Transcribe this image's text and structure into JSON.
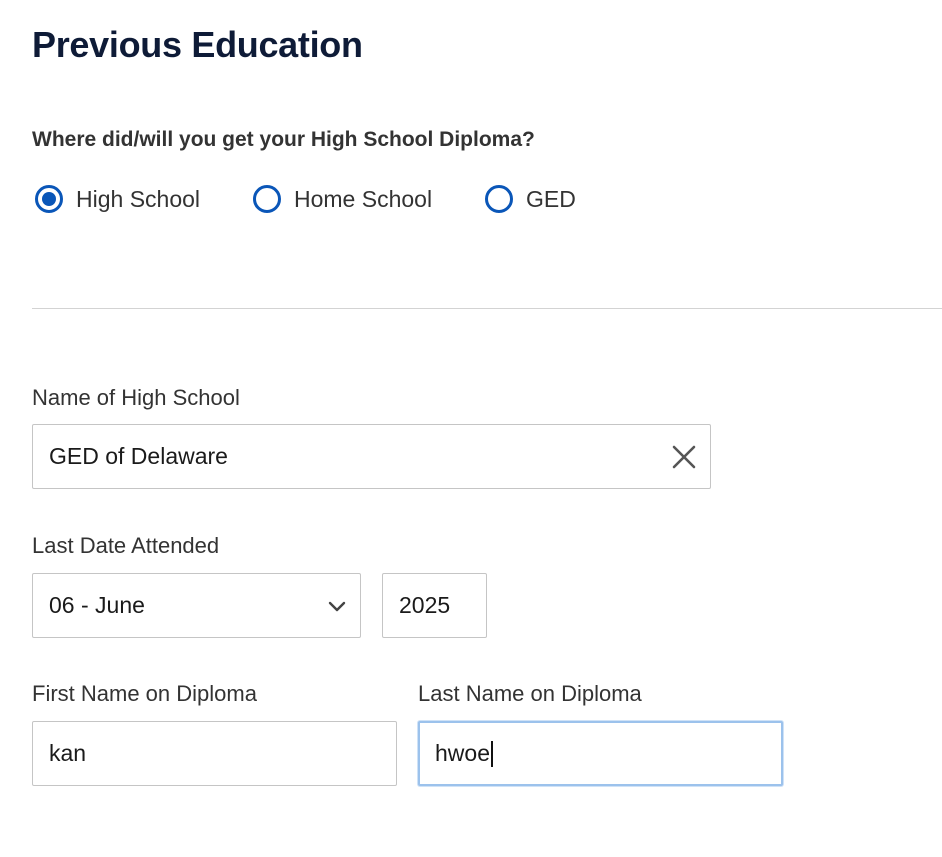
{
  "page": {
    "title": "Previous Education"
  },
  "diploma_source": {
    "question": "Where did/will you get your High School Diploma?",
    "options": [
      {
        "label": "High School",
        "selected": true
      },
      {
        "label": "Home School",
        "selected": false
      },
      {
        "label": "GED",
        "selected": false
      }
    ]
  },
  "high_school": {
    "label": "Name of High School",
    "value": "GED of Delaware",
    "clear_icon": "close-icon"
  },
  "last_date": {
    "label": "Last Date Attended",
    "month_value": "06 - June",
    "month_icon": "chevron-down-icon",
    "year_value": "2025"
  },
  "first_name": {
    "label": "First Name on Diploma",
    "value": "kan"
  },
  "last_name": {
    "label": "Last Name on Diploma",
    "value": "hwoe"
  },
  "colors": {
    "title": "#0e1b37",
    "accent": "#0a56b8",
    "text": "#333333",
    "focus_border": "#9cc2ec"
  }
}
